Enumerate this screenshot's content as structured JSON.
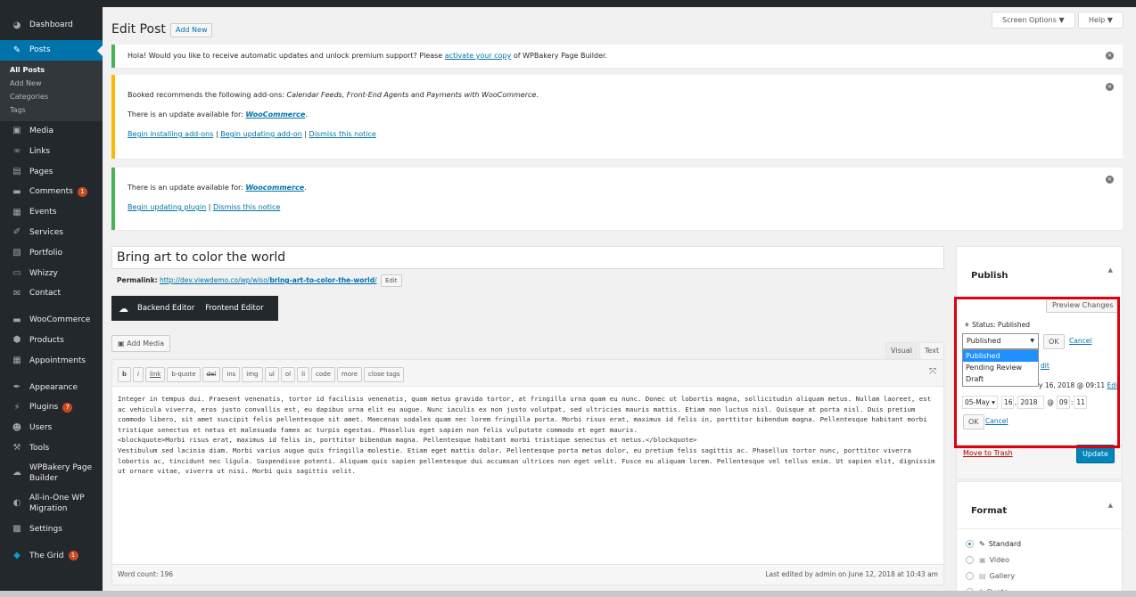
{
  "sidebar": {
    "dashboard": "Dashboard",
    "posts": "Posts",
    "posts_sub": [
      "All Posts",
      "Add New",
      "Categories",
      "Tags"
    ],
    "media": "Media",
    "links": "Links",
    "pages": "Pages",
    "comments": "Comments",
    "comments_badge": "1",
    "events": "Events",
    "services": "Services",
    "portfolio": "Portfolio",
    "whizzy": "Whizzy",
    "contact": "Contact",
    "woocommerce": "WooCommerce",
    "products": "Products",
    "appointments": "Appointments",
    "appearance": "Appearance",
    "plugins": "Plugins",
    "plugins_badge": "7",
    "users": "Users",
    "tools": "Tools",
    "wpbakery": "WPBakery Page Builder",
    "allinone": "All-in-One WP Migration",
    "settings": "Settings",
    "thegrid": "The Grid",
    "thegrid_badge": "1"
  },
  "header": {
    "title": "Edit Post",
    "add_new": "Add New",
    "screen_options": "Screen Options ▼",
    "help": "Help ▼"
  },
  "notices": {
    "n1_pre": "Hola! Would you like to receive automatic updates and unlock premium support? Please ",
    "n1_link": "activate your copy",
    "n1_post": " of WPBakery Page Builder.",
    "n2_line1_pre": "Booked recommends the following add-ons: ",
    "n2_line1_em": "Calendar Feeds, Front-End Agents",
    "n2_line1_mid": " and ",
    "n2_line1_em2": "Payments with WooCommerce",
    "n2_line1_end": ".",
    "n2_line2_pre": "There is an update available for: ",
    "n2_line2_link": "WooCommerce",
    "n2_line2_end": ".",
    "n2_link_a": "Begin installing add-ons",
    "n2_sep1": " | ",
    "n2_link_b": "Begin updating add-on",
    "n2_sep2": " | ",
    "n2_link_c": "Dismiss this notice",
    "n3_line1_pre": "There is an update available for: ",
    "n3_line1_link": "Woocommerce",
    "n3_line1_end": ".",
    "n3_link_a": "Begin updating plugin",
    "n3_sep": " | ",
    "n3_link_b": "Dismiss this notice"
  },
  "post": {
    "title": "Bring art to color the world",
    "permalink_label": "Permalink:",
    "permalink_base": "http://dev.viewdemo.co/wp/wiso/",
    "permalink_slug": "bring-art-to-color-the-world",
    "permalink_end": "/",
    "edit": "Edit",
    "backend_editor": "Backend Editor",
    "frontend_editor": "Frontend Editor",
    "add_media": "Add Media",
    "tab_visual": "Visual",
    "tab_text": "Text",
    "quicktags": [
      "b",
      "i",
      "link",
      "b-quote",
      "del",
      "ins",
      "img",
      "ul",
      "ol",
      "li",
      "code",
      "more",
      "close tags"
    ],
    "content": "Integer in tempus dui. Praesent venenatis, tortor id facilisis venenatis, quam metus gravida tortor, at fringilla urna quam eu nunc. Donec ut lobortis magna, sollicitudin aliquam metus. Nullam laoreet, est ac vehicula viverra, eros justo convallis est, eu dapibus urna elit eu augue. Nunc iaculis ex non justo volutpat, sed ultricies mauris mattis. Etiam non luctus nisl. Quisque at porta nisl. Duis pretium commodo libero, sit amet suscipit felis pellentesque sit amet. Maecenas sodales quam nec lorem fringilla porta. Morbi risus erat, maximus id felis in, porttitor bibendum magna. Pellentesque habitant morbi tristique senectus et netus et malesuada fames ac turpis egestas. Phasellus eget sapien non felis vulputate commodo et eget mauris.\n<blockquote>Morbi risus erat, maximus id felis in, porttitor bibendum magna. Pellentesque habitant morbi tristique senectus et netus.</blockquote>\nVestibulum sed lacinia diam. Morbi varius augue quis fringilla molestie. Etiam eget mattis dolor. Pellentesque porta metus dolor, eu pretium felis sagittis ac. Phasellus tortor nunc, porttitor viverra lobortis ac, tincidunt nec ligula. Suspendisse potenti. Aliquam quis sapien pellentesque dui accumsan ultrices non eget velit. Fusce eu aliquam lorem. Pellentesque vel tellus enim. Ut sapien elit, dignissim ut ornare vitae, viverra ut nisi. Morbi quis sagittis velit.",
    "word_count": "Word count: 196",
    "last_edited": "Last edited by admin on June 12, 2018 at 10:43 am"
  },
  "publish": {
    "title": "Publish",
    "preview": "Preview Changes",
    "status_label": "Status: Published",
    "select_value": "Published",
    "options": [
      "Published",
      "Pending Review",
      "Draft"
    ],
    "ok": "OK",
    "cancel": "Cancel",
    "edit_partial": "dit",
    "date_partial": "y 16, 2018 @ 09:11",
    "date_edit": "Edit",
    "month": "05-May",
    "day": "16",
    "year": "2018",
    "hour": "09",
    "minute": "11",
    "at": "@",
    "colon": ":",
    "ok2": "OK",
    "cancel2": "Cancel",
    "trash": "Move to Trash",
    "update": "Update"
  },
  "format": {
    "title": "Format",
    "options": [
      "Standard",
      "Video",
      "Gallery",
      "Quote"
    ],
    "selected": "Standard"
  },
  "colors": {
    "highlight_box": "#e0000b",
    "primary": "#0085ba",
    "sidebar_bg": "#23282d"
  }
}
